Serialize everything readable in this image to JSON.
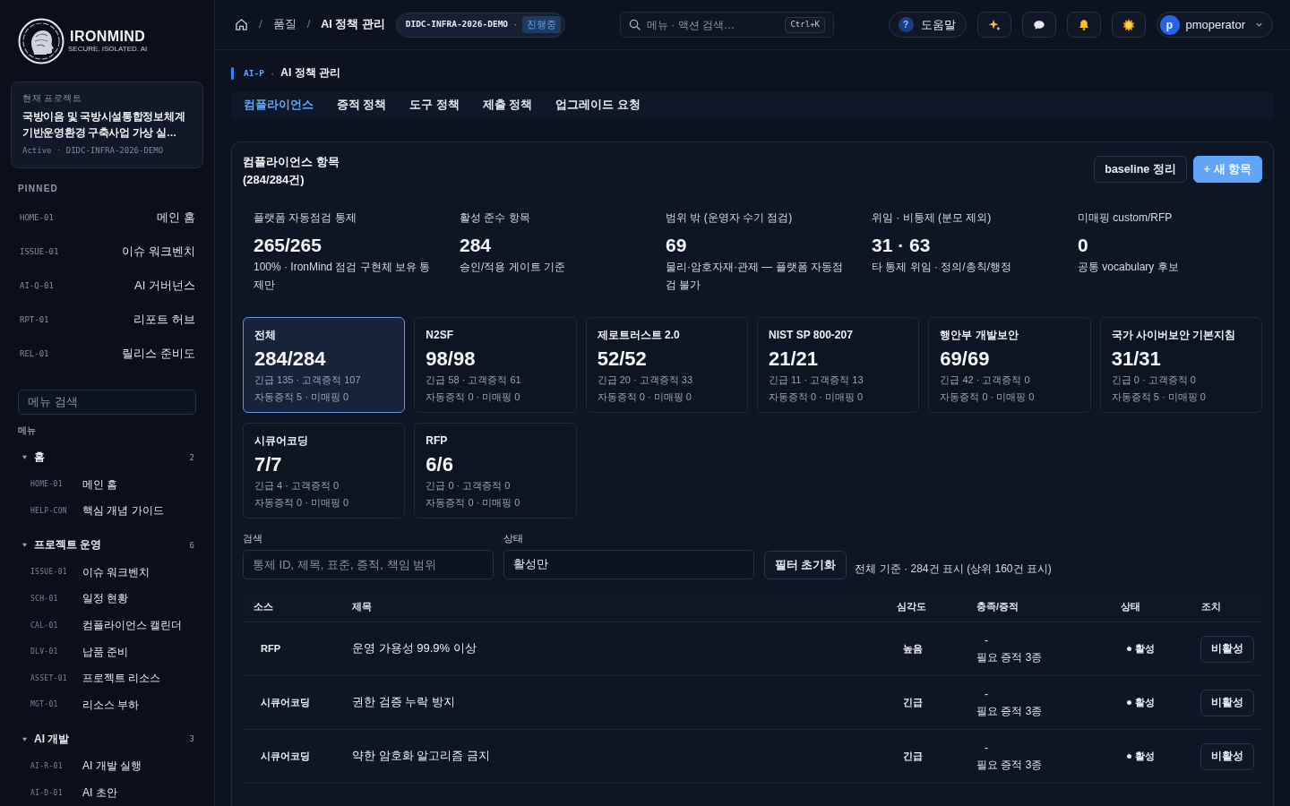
{
  "brand": {
    "name": "IRONMIND",
    "tagline": "SECURE. ISOLATED. AI"
  },
  "project": {
    "label": "현재 프로젝트",
    "name": "국방이음 및 국방시설통합정보체계 기반운영환경 구축사업 가상 실…",
    "meta": "Active · DIDC-INFRA-2026-DEMO"
  },
  "pinned": {
    "title": "PINNED",
    "items": [
      {
        "code": "HOME-01",
        "label": "메인 홈"
      },
      {
        "code": "ISSUE-01",
        "label": "이슈 워크벤치"
      },
      {
        "code": "AI-Q-01",
        "label": "AI 거버넌스"
      },
      {
        "code": "RPT-01",
        "label": "리포트 허브"
      },
      {
        "code": "REL-01",
        "label": "릴리스 준비도"
      }
    ]
  },
  "menu_search": {
    "placeholder": "메뉴 검색"
  },
  "menu": {
    "title": "메뉴",
    "groups": [
      {
        "label": "홈",
        "count": "2",
        "expanded": true,
        "items": [
          {
            "code": "HOME-01",
            "label": "메인 홈"
          },
          {
            "code": "HELP-CON",
            "label": "핵심 개념 가이드"
          }
        ]
      },
      {
        "label": "프로젝트 운영",
        "count": "6",
        "expanded": true,
        "items": [
          {
            "code": "ISSUE-01",
            "label": "이슈 워크벤치"
          },
          {
            "code": "SCH-01",
            "label": "일정 현황"
          },
          {
            "code": "CAL-01",
            "label": "컴플라이언스 캘린더"
          },
          {
            "code": "DLV-01",
            "label": "납품 준비"
          },
          {
            "code": "ASSET-01",
            "label": "프로젝트 리소스"
          },
          {
            "code": "MGT-01",
            "label": "리소스 부하"
          }
        ]
      },
      {
        "label": "AI 개발",
        "count": "3",
        "expanded": true,
        "items": [
          {
            "code": "AI-R-01",
            "label": "AI 개발 실행"
          },
          {
            "code": "AI-D-01",
            "label": "AI 초안"
          }
        ]
      }
    ]
  },
  "topbar": {
    "breadcrumb": {
      "separator": "/",
      "items": [
        "품질",
        "AI 정책 관리"
      ]
    },
    "project": {
      "code": "DIDC-INFRA-2026-DEMO",
      "separator": "·",
      "status": "진행중"
    },
    "search": {
      "placeholder": "메뉴 · 액션 검색…",
      "shortcut": "Ctrl+K"
    },
    "help": {
      "mark": "?",
      "label": "도움말"
    },
    "user": {
      "initial": "p",
      "name": "pmoperator"
    }
  },
  "page": {
    "code": "AI-P",
    "separator": "·",
    "title": "AI 정책 관리"
  },
  "tabs": [
    {
      "label": "컴플라이언스",
      "selected": true
    },
    {
      "label": "증적 정책",
      "selected": false
    },
    {
      "label": "도구 정책",
      "selected": false
    },
    {
      "label": "제출 정책",
      "selected": false
    },
    {
      "label": "업그레이드 요청",
      "selected": false
    }
  ],
  "panel": {
    "title": "컴플라이언스 항목",
    "count": "(284/284건)",
    "actions": [
      {
        "label": "baseline 정리",
        "kind": "secondary"
      },
      {
        "label": "+ 새 항목",
        "kind": "primary"
      }
    ],
    "stats": [
      {
        "label": "플랫폼 자동점검 통제",
        "value": "265/265",
        "note": "100% · IronMind 점검 구현체 보유 통제만"
      },
      {
        "label": "활성 준수 항목",
        "value": "284",
        "note": "승인/적용 게이트 기준"
      },
      {
        "label": "범위 밖 (운영자 수기 점검)",
        "value": "69",
        "note": "물리·암호자재·관제 — 플랫폼 자동점검 불가"
      },
      {
        "label": "위임 · 비통제 (분모 제외)",
        "value": "31 · 63",
        "note": "타 통제 위임 · 정의/총칙/행정"
      },
      {
        "label": "미매핑 custom/RFP",
        "value": "0",
        "note": "공통 vocabulary 후보"
      }
    ],
    "standards": [
      {
        "name": "전체",
        "value": "284/284",
        "urgent_line": "긴급 135 · 고객증적 107",
        "auto_line": "자동증적 5 · 미매핑 0",
        "selected": true
      },
      {
        "name": "N2SF",
        "value": "98/98",
        "urgent_line": "긴급 58 · 고객증적 61",
        "auto_line": "자동증적 0 · 미매핑 0",
        "selected": false
      },
      {
        "name": "제로트러스트 2.0",
        "value": "52/52",
        "urgent_line": "긴급 20 · 고객증적 33",
        "auto_line": "자동증적 0 · 미매핑 0",
        "selected": false
      },
      {
        "name": "NIST SP 800-207",
        "value": "21/21",
        "urgent_line": "긴급 11 · 고객증적 13",
        "auto_line": "자동증적 0 · 미매핑 0",
        "selected": false
      },
      {
        "name": "행안부 개발보안",
        "value": "69/69",
        "urgent_line": "긴급 42 · 고객증적 0",
        "auto_line": "자동증적 0 · 미매핑 0",
        "selected": false
      },
      {
        "name": "국가 사이버보안 기본지침",
        "value": "31/31",
        "urgent_line": "긴급 0 · 고객증적 0",
        "auto_line": "자동증적 5 · 미매핑 0",
        "selected": false
      },
      {
        "name": "시큐어코딩",
        "value": "7/7",
        "urgent_line": "긴급 4 · 고객증적 0",
        "auto_line": "자동증적 0 · 미매핑 0",
        "selected": false
      },
      {
        "name": "RFP",
        "value": "6/6",
        "urgent_line": "긴급 0 · 고객증적 0",
        "auto_line": "자동증적 0 · 미매핑 0",
        "selected": false
      }
    ],
    "filters": {
      "search": {
        "label": "검색",
        "placeholder": "통제 ID, 제목, 표준, 증적, 책임 범위"
      },
      "status": {
        "label": "상태",
        "value": "활성만"
      },
      "reset": "필터 초기화",
      "summary": "전체 기준 · 284건 표시 (상위 160건 표시)"
    },
    "table": {
      "columns": [
        "소스",
        "제목",
        "심각도",
        "충족/증적",
        "상태",
        "조치"
      ],
      "rows": [
        {
          "source": "RFP",
          "title": "운영 가용성 99.9% 이상",
          "severity": "높음",
          "fulfillment": "-",
          "evidence": "필요 증적 3종",
          "status": "활성",
          "action": "비활성"
        },
        {
          "source": "시큐어코딩",
          "title": "권한 검증 누락 방지",
          "severity": "긴급",
          "fulfillment": "-",
          "evidence": "필요 증적 3종",
          "status": "활성",
          "action": "비활성"
        },
        {
          "source": "시큐어코딩",
          "title": "약한 암호화 알고리즘 금지",
          "severity": "긴급",
          "fulfillment": "-",
          "evidence": "필요 증적 3종",
          "status": "활성",
          "action": "비활성"
        }
      ]
    }
  }
}
